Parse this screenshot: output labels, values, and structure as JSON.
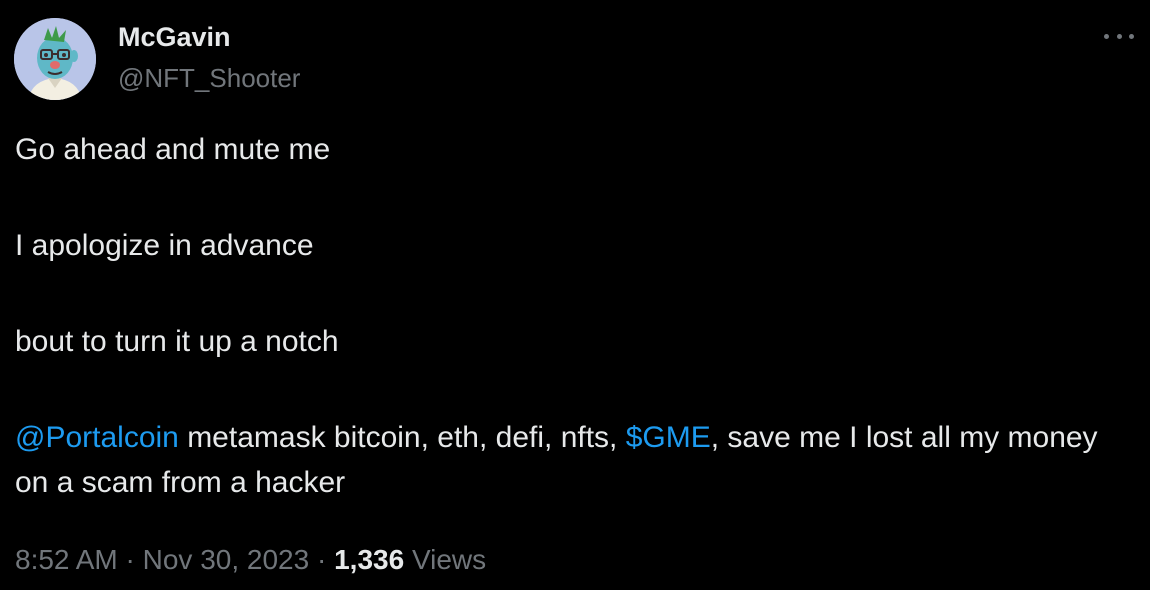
{
  "colors": {
    "background": "#000000",
    "text": "#e7e9ea",
    "secondary": "#71767b",
    "link": "#1d9bf0",
    "avatar_bg": "#b9c5e8"
  },
  "author": {
    "display_name": "McGavin",
    "handle": "@NFT_Shooter",
    "avatar_icon": "cartoon-character-avatar"
  },
  "menu": {
    "icon": "more-horizontal-icon"
  },
  "tweet": {
    "line1": "Go ahead and mute me",
    "line2": "I apologize in advance",
    "line3": "bout to turn it up a notch",
    "mention": "@Portalcoin",
    "text_after_mention": " metamask bitcoin, eth, defi, nfts, ",
    "cashtag": "$GME",
    "text_after_cashtag": ", save me I lost all my money on a scam from a hacker"
  },
  "meta": {
    "time": "8:52 AM",
    "separator": " · ",
    "date": "Nov 30, 2023",
    "views_count": "1,336",
    "views_label": " Views"
  }
}
